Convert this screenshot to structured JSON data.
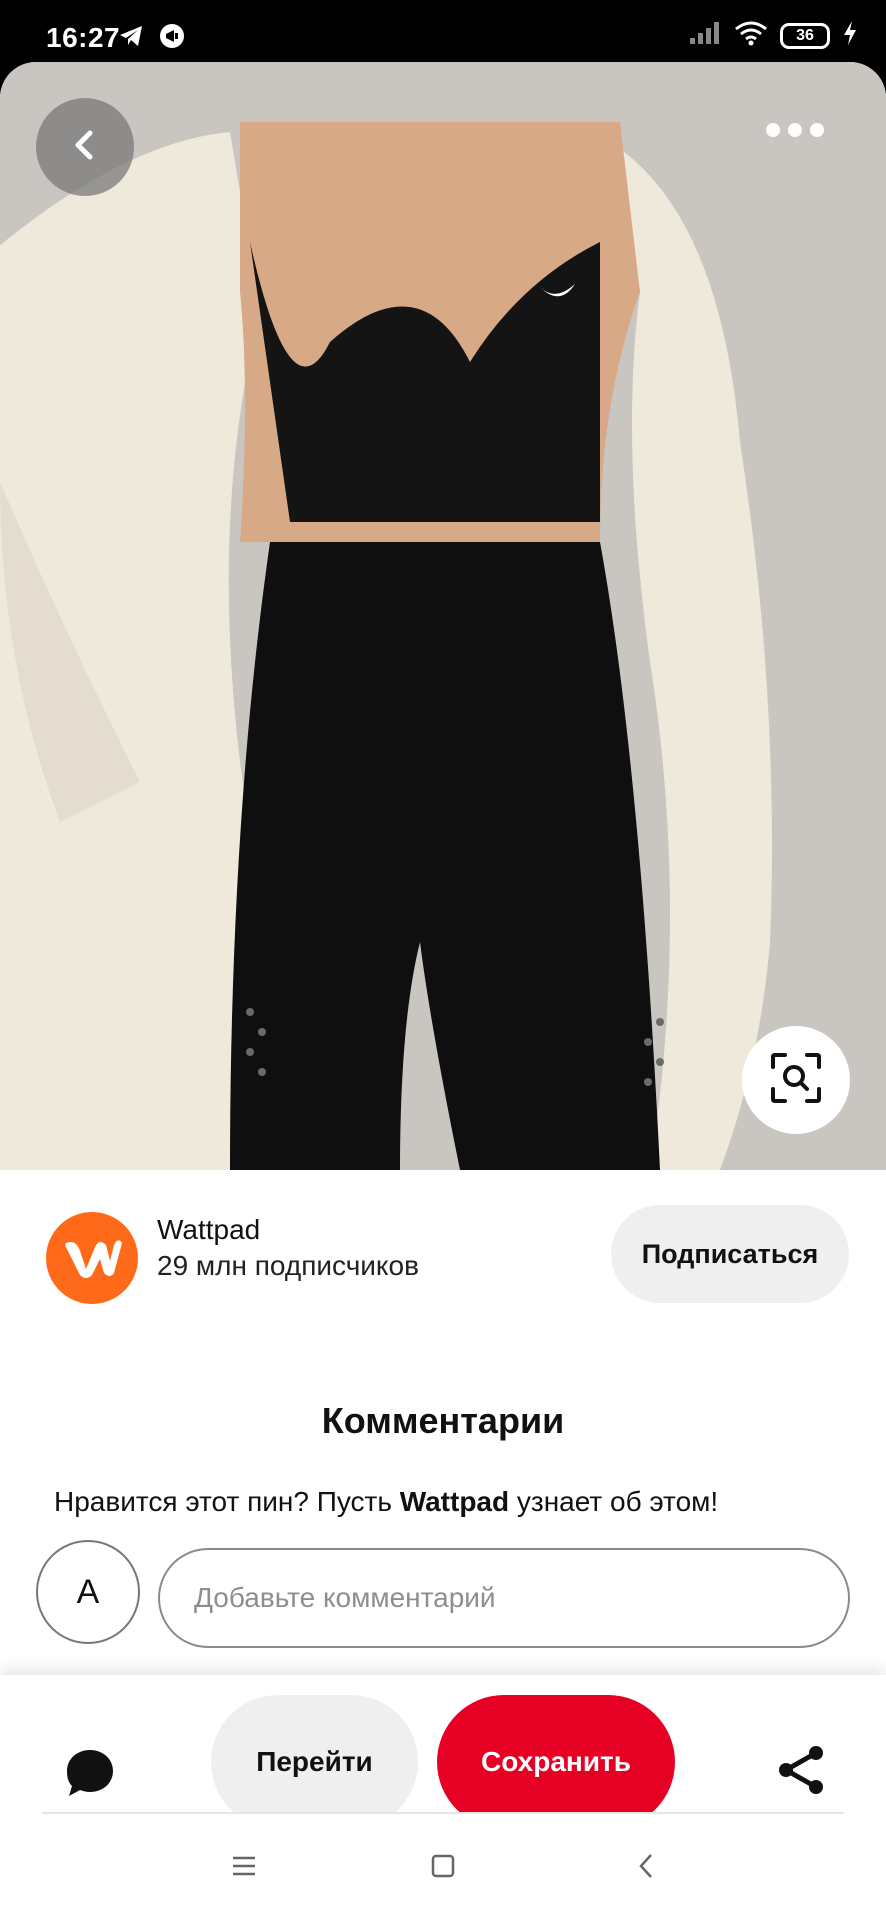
{
  "status_bar": {
    "time": "16:27",
    "battery": "36",
    "icons": [
      "telegram-icon",
      "vpn-icon",
      "signal-icon",
      "wifi-icon",
      "battery-icon",
      "charging-icon"
    ]
  },
  "pin": {
    "image_description_icon": "photo",
    "back_icon": "chevron-left-icon",
    "more_icon": "more-horizontal-icon",
    "lens_icon": "visual-search-icon"
  },
  "creator": {
    "name": "Wattpad",
    "followers": "29 млн подписчиков",
    "follow_label": "Подписаться",
    "avatar_letter": "W",
    "brand_color": "#ff6a1a"
  },
  "comments": {
    "title": "Комментарии",
    "prompt_before": "Нравится этот пин? Пусть ",
    "prompt_name": "Wattpad",
    "prompt_after": " узнает об этом!",
    "user_initial": "A",
    "input_placeholder": "Добавьте комментарий"
  },
  "actions": {
    "visit_label": "Перейти",
    "save_label": "Сохранить",
    "save_color": "#e60023",
    "chat_icon": "chat-bubble-icon",
    "share_icon": "share-icon"
  },
  "system_nav": {
    "icons": [
      "menu-icon",
      "home-icon",
      "back-icon"
    ]
  }
}
